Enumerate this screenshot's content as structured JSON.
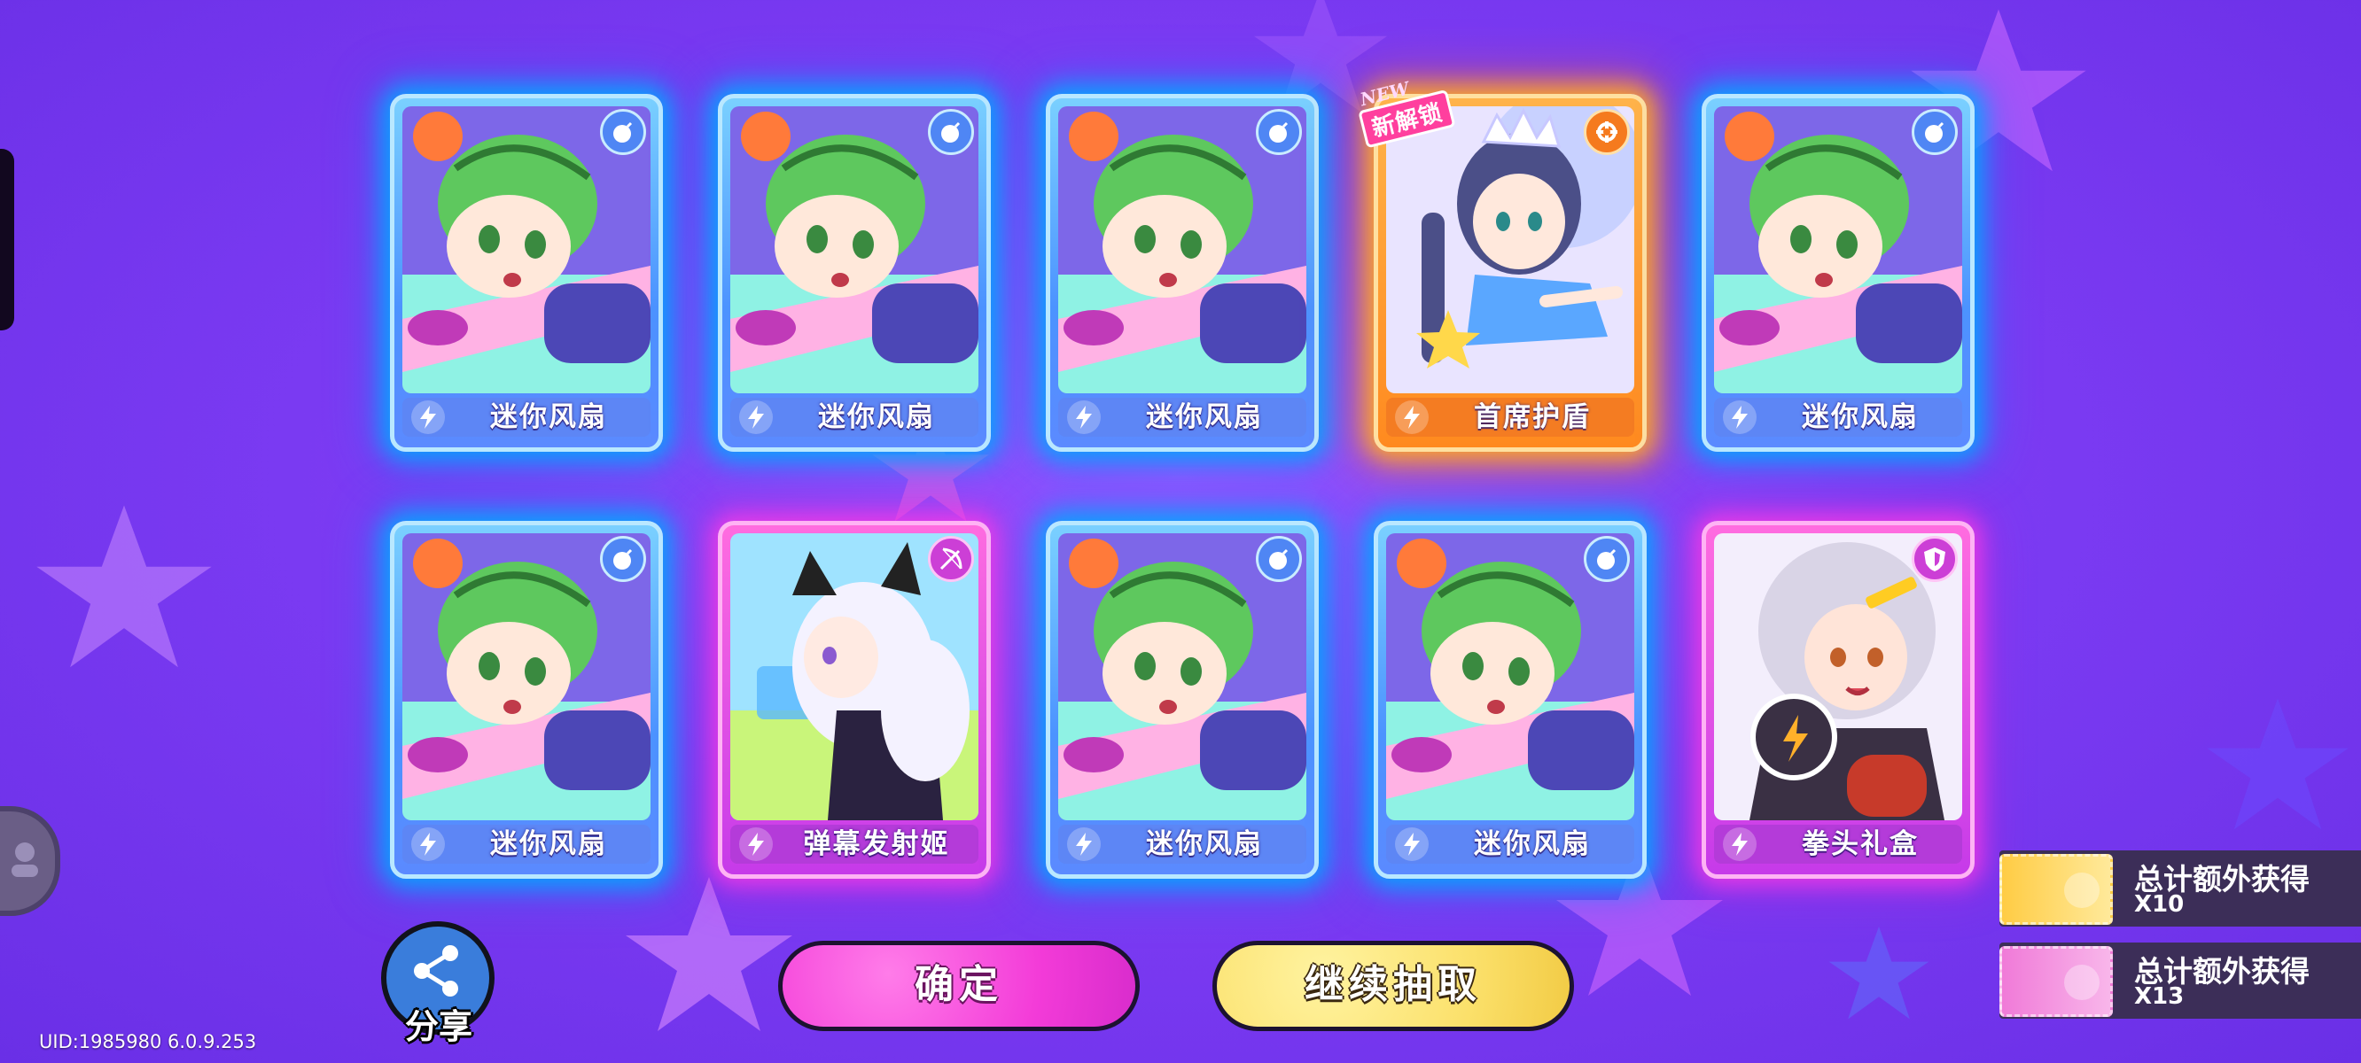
{
  "cards": [
    {
      "name": "迷你风扇",
      "rarity": "blue",
      "type_icon": "bomb-icon",
      "art": "green-helmet-girl"
    },
    {
      "name": "迷你风扇",
      "rarity": "blue",
      "type_icon": "bomb-icon",
      "art": "green-helmet-girl"
    },
    {
      "name": "迷你风扇",
      "rarity": "blue",
      "type_icon": "bomb-icon",
      "art": "green-helmet-girl"
    },
    {
      "name": "首席护盾",
      "rarity": "orange",
      "type_icon": "gear-icon",
      "art": "crowned-girl",
      "badge_en": "NEW",
      "badge_cn": "新解锁"
    },
    {
      "name": "迷你风扇",
      "rarity": "blue",
      "type_icon": "bomb-icon",
      "art": "green-helmet-girl"
    },
    {
      "name": "迷你风扇",
      "rarity": "blue",
      "type_icon": "bomb-icon",
      "art": "green-helmet-girl"
    },
    {
      "name": "弹幕发射姬",
      "rarity": "pink",
      "type_icon": "bow-icon",
      "art": "white-hair-cat-girl"
    },
    {
      "name": "迷你风扇",
      "rarity": "blue",
      "type_icon": "bomb-icon",
      "art": "green-helmet-girl"
    },
    {
      "name": "迷你风扇",
      "rarity": "blue",
      "type_icon": "bomb-icon",
      "art": "green-helmet-girl"
    },
    {
      "name": "拳头礼盒",
      "rarity": "pink",
      "type_icon": "shield-icon",
      "art": "boxing-girl"
    }
  ],
  "buttons": {
    "share": "分享",
    "confirm": "确定",
    "continue": "继续抽取"
  },
  "rewards": [
    {
      "title": "总计额外获得",
      "count": "X10",
      "ticket": "gold"
    },
    {
      "title": "总计额外获得",
      "count": "X13",
      "ticket": "pink"
    }
  ],
  "uid": "UID:1985980 6.0.9.253",
  "colors": {
    "background": "#7d3cf4",
    "card_blue": "#4c93ff",
    "card_orange": "#ff8a1f",
    "card_pink": "#c63ae9",
    "confirm_button": "#f33bd8",
    "continue_button": "#fbe06a"
  }
}
